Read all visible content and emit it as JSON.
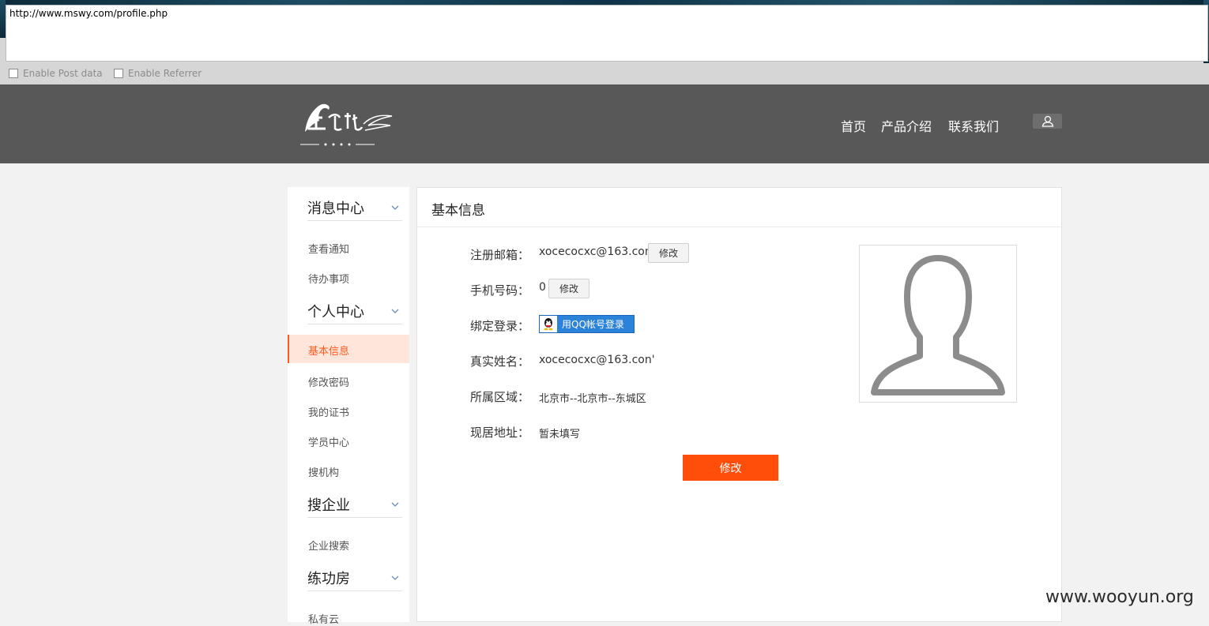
{
  "hackbar": {
    "url": "http://www.mswy.com/profile.php",
    "post_label": "Enable Post data",
    "referrer_label": "Enable Referrer"
  },
  "header": {
    "nav": [
      "首页",
      "产品介绍",
      "联系我们"
    ],
    "user_icon": "user-icon"
  },
  "sidebar": {
    "sections": [
      {
        "title": "消息中心",
        "items": [
          "查看通知",
          "待办事项"
        ]
      },
      {
        "title": "个人中心",
        "items": [
          "基本信息",
          "修改密码",
          "我的证书",
          "学员中心",
          "搜机构"
        ]
      },
      {
        "title": "搜企业",
        "items": [
          "企业搜索"
        ]
      },
      {
        "title": "练功房",
        "items": [
          "私有云"
        ]
      }
    ],
    "active_item": "基本信息"
  },
  "main": {
    "title": "基本信息",
    "fields": [
      {
        "label": "注册邮箱：",
        "value": "xocecocxc@163.con"
      },
      {
        "label": "手机号码：",
        "value": "0"
      },
      {
        "label": "绑定登录：",
        "value": ""
      },
      {
        "label": "真实姓名：",
        "value": "xocecocxc@163.con'"
      },
      {
        "label": "所属区域：",
        "value": "北京市--北京市--东城区"
      },
      {
        "label": "现居地址：",
        "value": "暂未填写"
      }
    ],
    "edit_btn": "修改",
    "qq_btn": "用QQ帐号登录",
    "submit_btn": "修改"
  },
  "watermark": "www.wooyun.org"
}
